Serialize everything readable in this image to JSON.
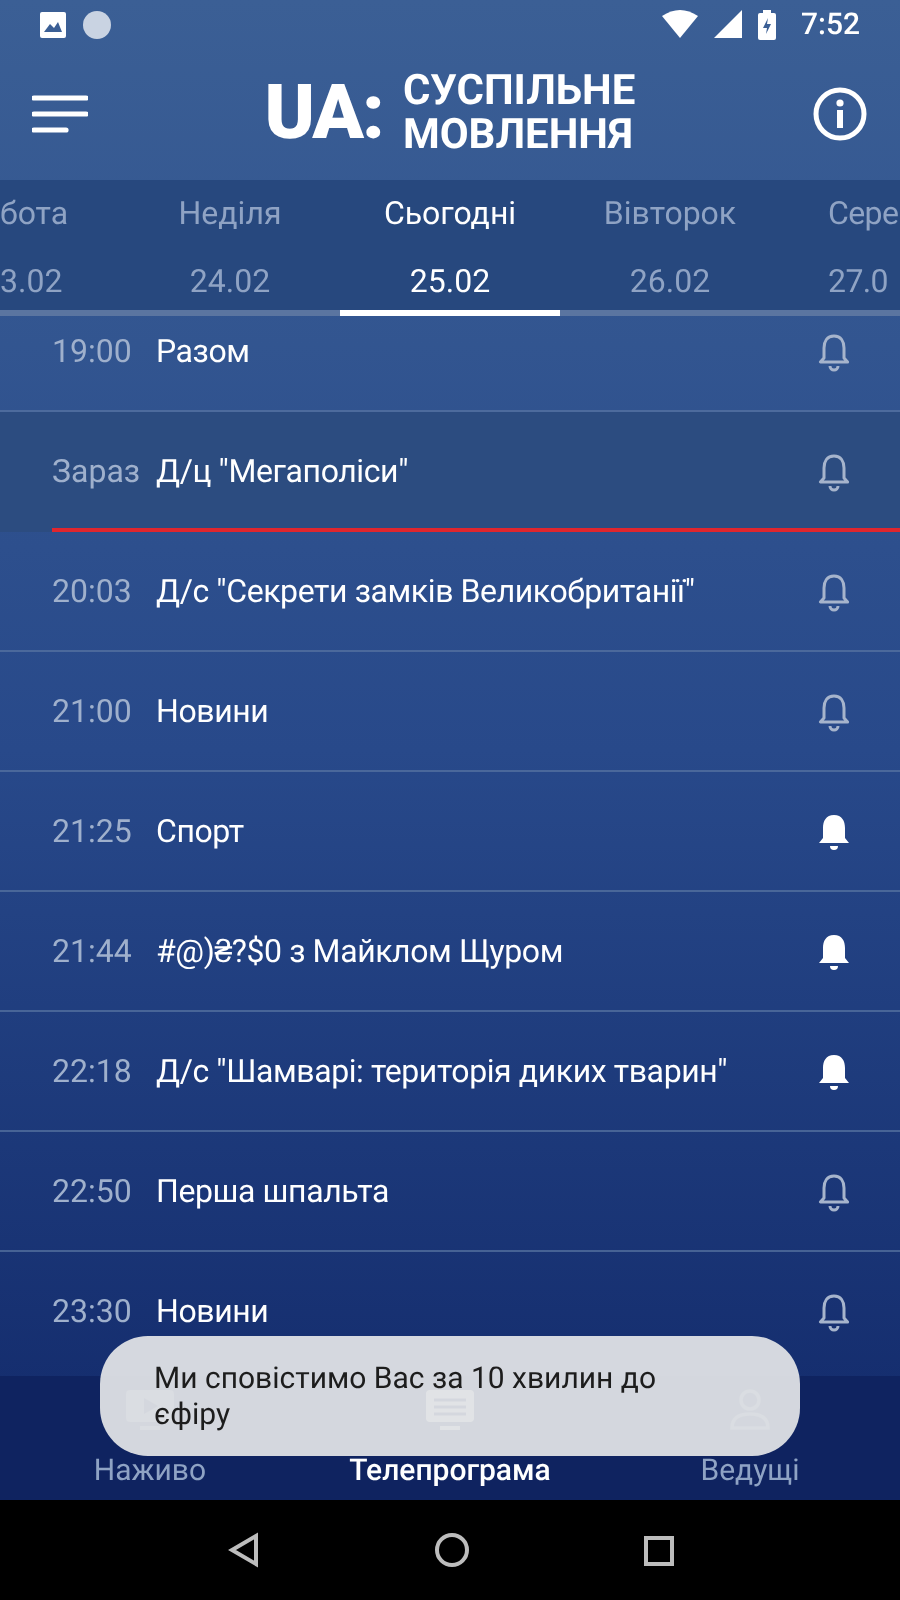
{
  "status_bar": {
    "time": "7:52"
  },
  "header": {
    "logo_mark": "UA:",
    "logo_lines": [
      "СУСПІЛЬНЕ",
      "МОВЛЕННЯ"
    ]
  },
  "tabs": [
    {
      "day": "бота",
      "date": "3.02",
      "selected": false
    },
    {
      "day": "Неділя",
      "date": "24.02",
      "selected": false
    },
    {
      "day": "Сьогодні",
      "date": "25.02",
      "selected": true
    },
    {
      "day": "Вівторок",
      "date": "26.02",
      "selected": false
    },
    {
      "day": "Сере",
      "date": "27.0",
      "selected": false
    }
  ],
  "programs": [
    {
      "time": "19:00",
      "title": "Разом",
      "current": false,
      "reminder": false
    },
    {
      "time": "Зараз",
      "title": "Д/ц \"Мегаполіси\"",
      "current": true,
      "reminder": false
    },
    {
      "time": "20:03",
      "title": "Д/с \"Секрети замків Великобританії\"",
      "current": false,
      "reminder": false
    },
    {
      "time": "21:00",
      "title": "Новини",
      "current": false,
      "reminder": false
    },
    {
      "time": "21:25",
      "title": "Спорт",
      "current": false,
      "reminder": true
    },
    {
      "time": "21:44",
      "title": "#@)₴?$0 з Майклом Щуром",
      "current": false,
      "reminder": true
    },
    {
      "time": "22:18",
      "title": "Д/с \"Шамварі: територія диких тварин\"",
      "current": false,
      "reminder": true
    },
    {
      "time": "22:50",
      "title": "Перша шпальта",
      "current": false,
      "reminder": false
    },
    {
      "time": "23:30",
      "title": "Новини",
      "current": false,
      "reminder": false
    }
  ],
  "bottom_nav": [
    {
      "label": "Наживо",
      "kind": "tv",
      "selected": false
    },
    {
      "label": "Телепрограма",
      "kind": "list",
      "selected": true
    },
    {
      "label": "Ведущі",
      "kind": "person",
      "selected": false
    }
  ],
  "toast": {
    "text": "Ми сповістимо Вас за 10 хвилин до єфіру"
  }
}
